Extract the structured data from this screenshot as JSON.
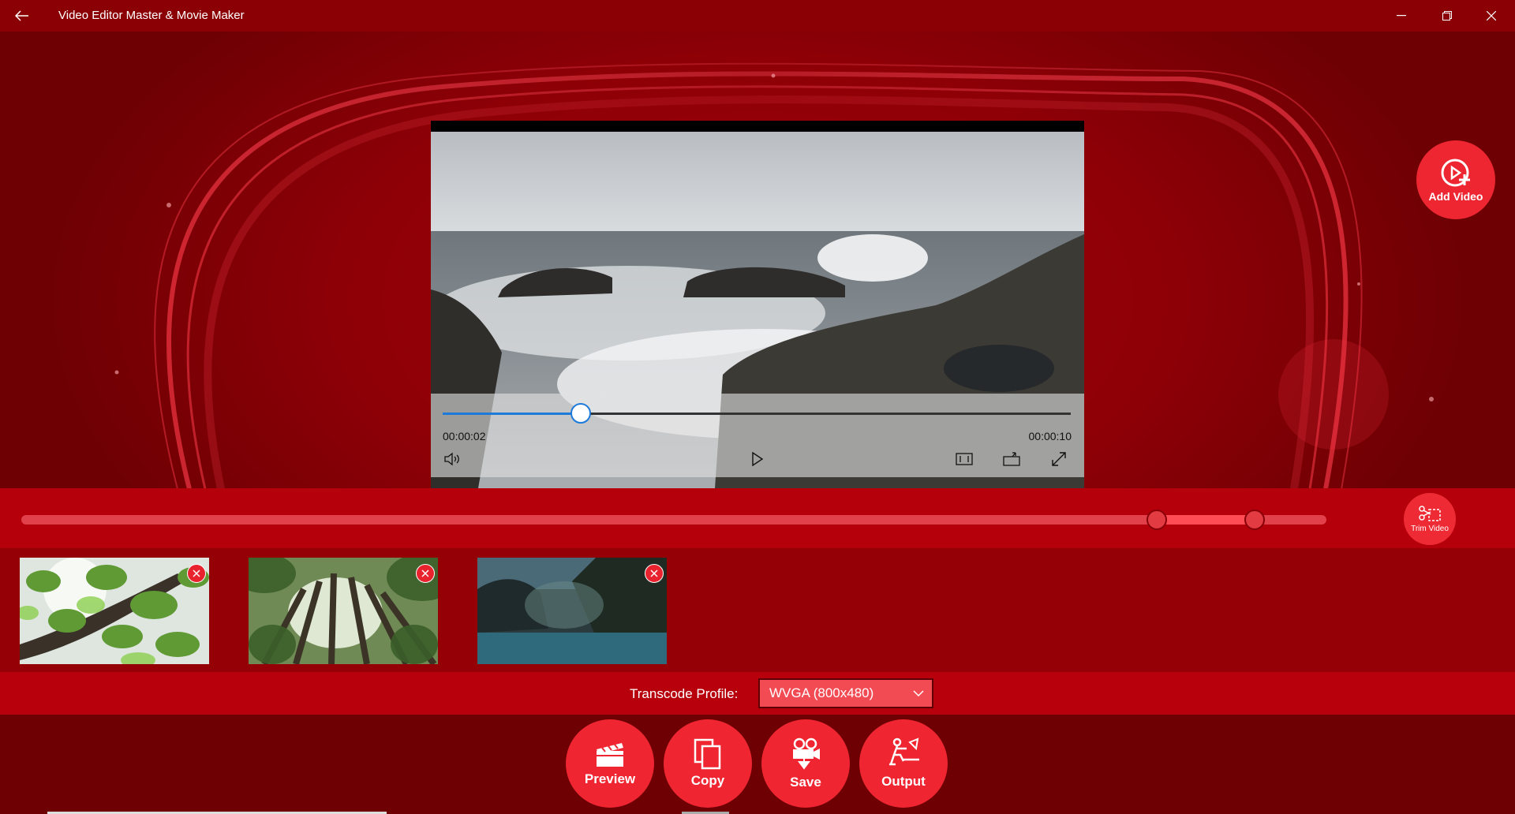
{
  "window": {
    "title": "Video Editor Master & Movie Maker",
    "controls": [
      "back-icon",
      "minimize-icon",
      "restore-icon",
      "close-icon"
    ]
  },
  "player": {
    "current_time": "00:00:02",
    "total_time": "00:00:10",
    "progress": 0.22,
    "icons": [
      "volume-icon",
      "play-icon",
      "aspect-ratio-icon",
      "cast-icon",
      "fullscreen-icon"
    ]
  },
  "add_video": {
    "label": "Add Video",
    "icon": "add-video-icon"
  },
  "trim": {
    "label": "Trim Video",
    "start": 0.87,
    "end": 0.945,
    "icon": "scissors-icon"
  },
  "clips": [
    {
      "name": "leaves"
    },
    {
      "name": "forest"
    },
    {
      "name": "coast"
    }
  ],
  "transcode": {
    "label": "Transcode Profile:",
    "selected": "WVGA (800x480)"
  },
  "actions": [
    {
      "label": "Preview",
      "icon": "clapperboard-icon"
    },
    {
      "label": "Copy",
      "icon": "copy-icon"
    },
    {
      "label": "Save",
      "icon": "camera-save-icon"
    },
    {
      "label": "Output",
      "icon": "output-icon"
    }
  ],
  "colors": {
    "background": "#8c0006",
    "accent": "#ef2631",
    "seek": "#1e7ad8"
  }
}
